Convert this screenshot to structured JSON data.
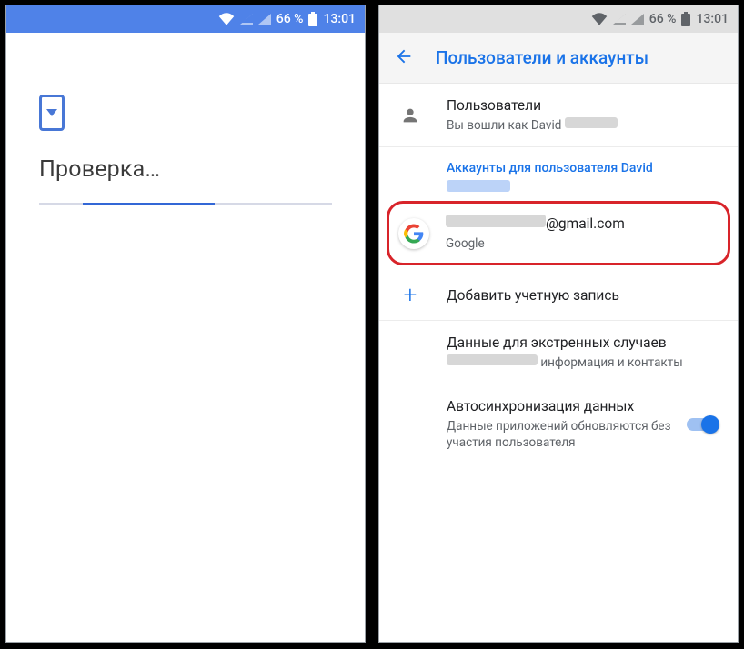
{
  "statusbar": {
    "battery": "66 %",
    "time": "13:01"
  },
  "left": {
    "title": "Проверка…"
  },
  "right": {
    "appbar": {
      "title": "Пользователи и аккаунты"
    },
    "users": {
      "title": "Пользователи",
      "subtitle_prefix": "Вы вошли как David"
    },
    "section_label": "Аккаунты для пользователя David",
    "account": {
      "email_suffix": "@gmail.com",
      "provider": "Google"
    },
    "add_account": "Добавить учетную запись",
    "emergency": {
      "title": "Данные для экстренных случаев",
      "subtitle_suffix": "информация и контакты"
    },
    "autosync": {
      "title": "Автосинхронизация данных",
      "subtitle": "Данные приложений обновляются без участия пользователя"
    }
  }
}
